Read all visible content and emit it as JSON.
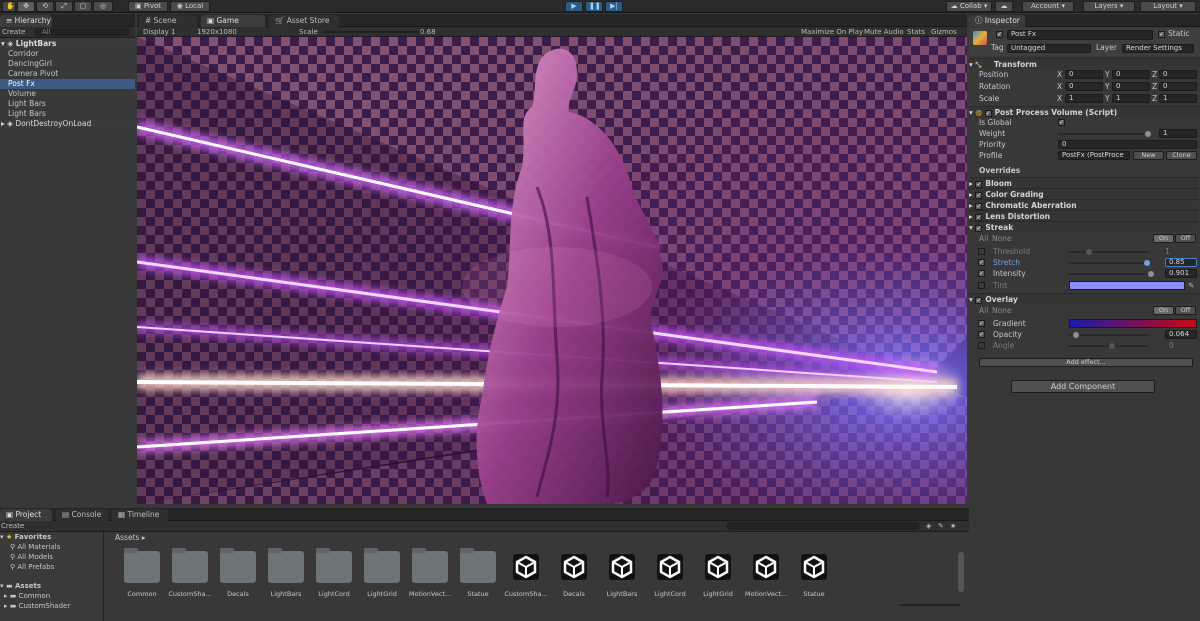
{
  "toolbar": {
    "pivot": "Pivot",
    "local": "Local",
    "collab": "Collab",
    "account": "Account",
    "layers": "Layers",
    "layout": "Layout"
  },
  "hierarchy": {
    "tab": "Hierarchy",
    "create": "Create",
    "search_placeholder": "All",
    "scene_name": "LightBars",
    "items": [
      "Corridor",
      "DancingGirl",
      "Camera Pivot",
      "Post Fx",
      "Volume",
      "Light Bars",
      "Light Bars"
    ],
    "selected_index": 3,
    "dont_destroy": "DontDestroyOnLoad"
  },
  "center_tabs": {
    "scene": "Scene",
    "game": "Game",
    "asset_store": "Asset Store"
  },
  "game_bar": {
    "display": "Display 1",
    "resolution": "1920x1080",
    "scale_label": "Scale",
    "scale_value": "0.68",
    "maximize": "Maximize On Play",
    "mute": "Mute Audio",
    "stats": "Stats",
    "gizmos": "Gizmos"
  },
  "inspector": {
    "tab": "Inspector",
    "object_name": "Post Fx",
    "static_label": "Static",
    "tag_label": "Tag",
    "tag_value": "Untagged",
    "layer_label": "Layer",
    "layer_value": "Render Settings",
    "transform": {
      "title": "Transform",
      "rows": [
        {
          "label": "Position",
          "x": "0",
          "y": "0",
          "z": "0"
        },
        {
          "label": "Rotation",
          "x": "0",
          "y": "0",
          "z": "0"
        },
        {
          "label": "Scale",
          "x": "1",
          "y": "1",
          "z": "1"
        }
      ]
    },
    "ppv": {
      "title": "Post Process Volume (Script)",
      "is_global": "Is Global",
      "weight_label": "Weight",
      "weight_value": "1",
      "priority_label": "Priority",
      "priority_value": "0",
      "profile_label": "Profile",
      "profile_value": "PostFx (PostProce",
      "new_btn": "New",
      "clone_btn": "Clone"
    },
    "overrides_label": "Overrides",
    "effects": [
      "Bloom",
      "Color Grading",
      "Chromatic Aberration",
      "Lens Distortion"
    ],
    "streak": {
      "title": "Streak",
      "all": "All",
      "none": "None",
      "on": "On",
      "off": "Off",
      "threshold_label": "Threshold",
      "threshold_value": "1",
      "stretch_label": "Stretch",
      "stretch_value": "0.85",
      "intensity_label": "Intensity",
      "intensity_value": "0.901",
      "tint_label": "Tint"
    },
    "overlay": {
      "title": "Overlay",
      "all": "All",
      "none": "None",
      "on": "On",
      "off": "Off",
      "gradient_label": "Gradient",
      "opacity_label": "Opacity",
      "opacity_value": "0.064",
      "angle_label": "Angle",
      "angle_value": "0"
    },
    "add_effect": "Add effect...",
    "add_component": "Add Component"
  },
  "bottom_tabs": {
    "project": "Project",
    "console": "Console",
    "timeline": "Timeline"
  },
  "project": {
    "create": "Create",
    "favorites": "Favorites",
    "fav_items": [
      "All Materials",
      "All Models",
      "All Prefabs"
    ],
    "assets_root": "Assets",
    "tree": [
      "Common",
      "CustomShader"
    ],
    "breadcrumb": "Assets",
    "folders": [
      "Common",
      "CustomSha...",
      "Decals",
      "LightBars",
      "LightCord",
      "LightGrid",
      "MotionVect...",
      "Statue"
    ],
    "scenes": [
      "CustomSha...",
      "Decals",
      "LightBars",
      "LightCord",
      "LightGrid",
      "MotionVect...",
      "Statue"
    ]
  },
  "colors": {
    "selection": "#3d5b82",
    "tint": "#8e8eff",
    "gradient_start": "#1a1aa8",
    "gradient_end": "#c80a14",
    "play_blue": "#2d5b86"
  }
}
